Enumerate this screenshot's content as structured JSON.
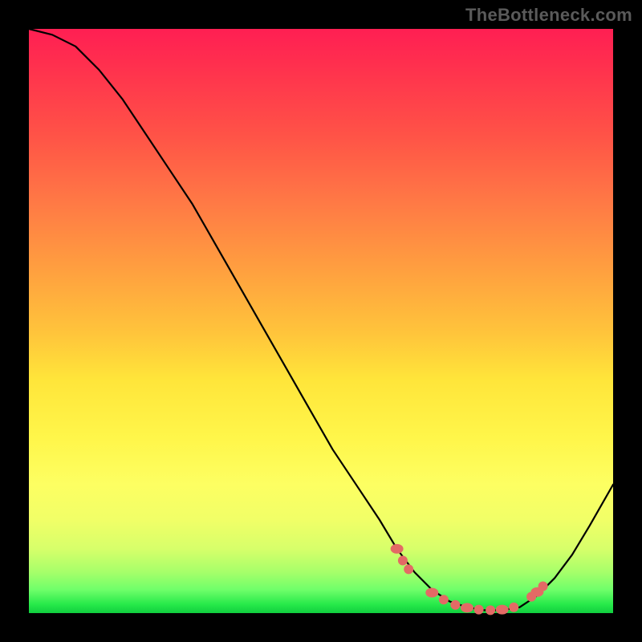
{
  "watermark": "TheBottleneck.com",
  "colors": {
    "frame": "#000000",
    "watermark": "#5a5a5a",
    "curve": "#000000",
    "marker": "#e36a65",
    "gradient_top": "#ff1f53",
    "gradient_mid": "#fff64a",
    "gradient_bottom": "#10cf3f"
  },
  "chart_data": {
    "type": "line",
    "title": "",
    "xlabel": "",
    "ylabel": "",
    "xlim": [
      0,
      100
    ],
    "ylim": [
      0,
      100
    ],
    "grid": false,
    "description": "V-shaped curve starting at top-left (high value), descending roughly linearly to a broad minimum near x≈70–83 (y≈0), then rising toward the right edge. A cluster of salmon-red markers sits along the valley floor.",
    "series": [
      {
        "name": "curve",
        "x": [
          0,
          4,
          8,
          12,
          16,
          20,
          24,
          28,
          32,
          36,
          40,
          44,
          48,
          52,
          56,
          60,
          63,
          66,
          69,
          72,
          75,
          78,
          81,
          84,
          87,
          90,
          93,
          96,
          100
        ],
        "y": [
          100,
          99,
          97,
          93,
          88,
          82,
          76,
          70,
          63,
          56,
          49,
          42,
          35,
          28,
          22,
          16,
          11,
          7,
          4,
          2,
          1,
          0.5,
          0.5,
          1,
          3,
          6,
          10,
          15,
          22
        ]
      }
    ],
    "markers": [
      {
        "x": 63,
        "y": 11
      },
      {
        "x": 64,
        "y": 9
      },
      {
        "x": 65,
        "y": 7.5
      },
      {
        "x": 69,
        "y": 3.5
      },
      {
        "x": 71,
        "y": 2.3
      },
      {
        "x": 73,
        "y": 1.4
      },
      {
        "x": 75,
        "y": 0.9
      },
      {
        "x": 77,
        "y": 0.6
      },
      {
        "x": 79,
        "y": 0.5
      },
      {
        "x": 81,
        "y": 0.6
      },
      {
        "x": 83,
        "y": 1.0
      },
      {
        "x": 86,
        "y": 2.8
      },
      {
        "x": 87,
        "y": 3.6
      },
      {
        "x": 88,
        "y": 4.6
      }
    ]
  }
}
